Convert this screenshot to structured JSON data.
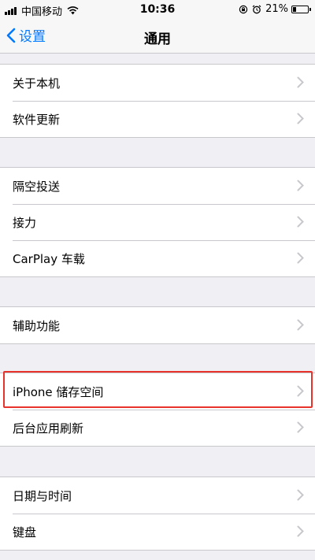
{
  "status_bar": {
    "carrier": "中国移动",
    "time": "10:36",
    "battery_percent": "21%",
    "battery_level": 0.21
  },
  "nav": {
    "back_label": "设置",
    "title": "通用"
  },
  "groups": [
    [
      "关于本机",
      "软件更新"
    ],
    [
      "隔空投送",
      "接力",
      "CarPlay 车载"
    ],
    [
      "辅助功能"
    ],
    [
      "iPhone 储存空间",
      "后台应用刷新"
    ],
    [
      "日期与时间",
      "键盘"
    ]
  ],
  "highlighted_item": "iPhone 储存空间",
  "colors": {
    "accent": "#007aff",
    "highlight": "#e8322c",
    "background": "#efeff4"
  }
}
